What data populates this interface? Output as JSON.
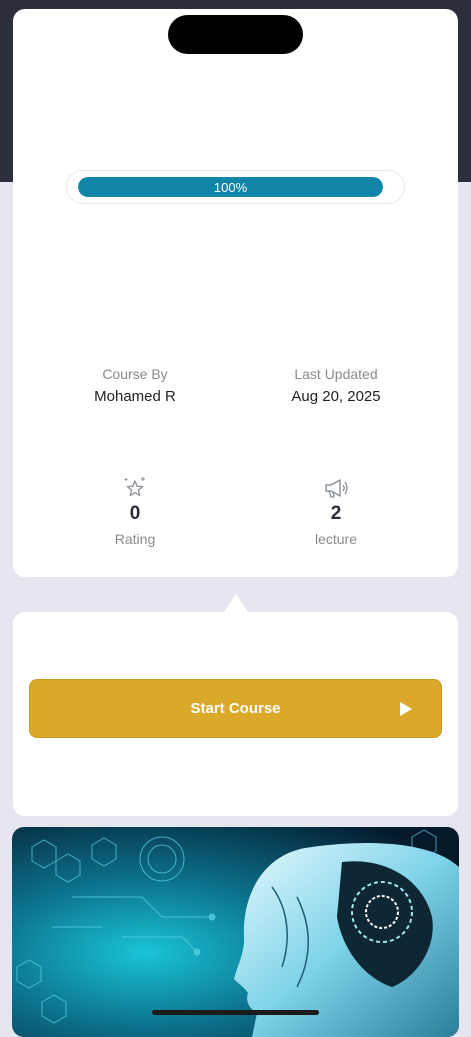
{
  "progress": {
    "label": "100%",
    "fraction": 1.0
  },
  "meta": {
    "course_by_label": "Course By",
    "course_by_value": "Mohamed R",
    "updated_label": "Last Updated",
    "updated_value": "Aug 20, 2025"
  },
  "stats": {
    "rating": {
      "value": "0",
      "label": "Rating",
      "icon": "star-sparkle-icon"
    },
    "lecture": {
      "value": "2",
      "label": "lecture",
      "icon": "megaphone-icon"
    }
  },
  "actions": {
    "start_label": "Start Course",
    "start_icon": "play-icon"
  },
  "colors": {
    "header_dark": "#2b2f3b",
    "progress_fill": "#1185a8",
    "button_gold": "#dba92a",
    "page_bg": "#e6e6f0"
  }
}
